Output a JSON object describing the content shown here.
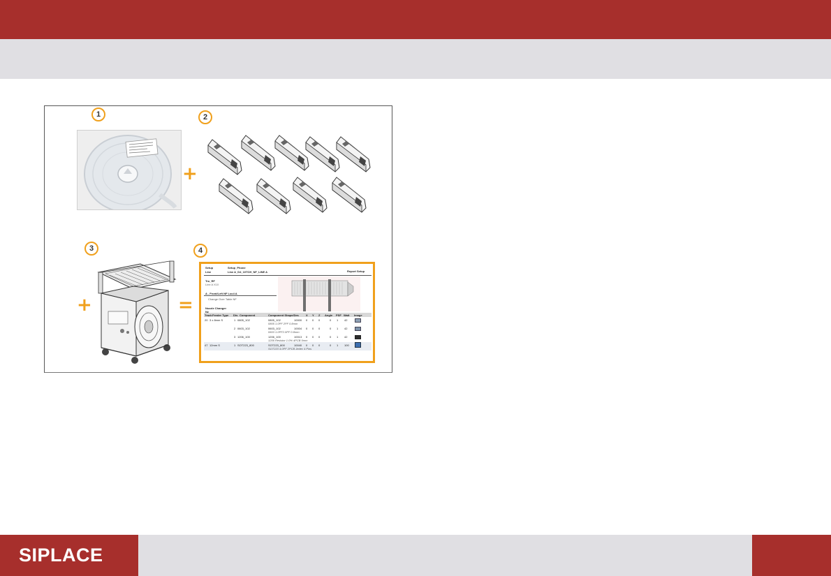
{
  "header": {
    "bar_color": "#a72f2c",
    "subbar_color": "#e0dfe3"
  },
  "figure": {
    "steps": [
      {
        "label": "1"
      },
      {
        "label": "2"
      },
      {
        "label": "3"
      },
      {
        "label": "4"
      }
    ],
    "operators": {
      "plus_1": "+",
      "plus_2": "+",
      "equals": "="
    },
    "accent_color": "#f0a01c",
    "report": {
      "setup_label": "Setup",
      "setup_value": "Setup_Phone",
      "line_label": "Line",
      "line_value": "Line A_D4_10TCH_NF_LINE A",
      "report_link": "Report Setup",
      "trolley_title": "Tro_RF",
      "trolley_sub": "Line A X10",
      "location_title": "A - Front/Left NF Loc4 A",
      "location_sub": "Change Over Table NF",
      "nozzle_title": "Nozzle Changer",
      "nozzle_sub": "Nz",
      "columns": [
        "Track",
        "Feeder Type",
        "Div.",
        "Component",
        "Component Shape/Des",
        "X",
        "Y",
        "Z",
        "Angle",
        "PSF",
        "Wait",
        "Image"
      ],
      "rows": [
        {
          "track": "20",
          "feeder": "3 x 8mm S",
          "div": "1",
          "comp": "0805_102",
          "shape": "0805_102",
          "code": "10000",
          "x": "0",
          "y": "0",
          "z": "0",
          "angle": "0",
          "psf": "1",
          "wait": "42",
          "desc": "0805 1.0PF 2PF 0.8mm"
        },
        {
          "track": "",
          "feeder": "",
          "div": "2",
          "comp": "0603_102",
          "shape": "0603_102",
          "code": "10004",
          "x": "0",
          "y": "0",
          "z": "0",
          "angle": "0",
          "psf": "1",
          "wait": "42",
          "desc": "0603 1.0PF2.0PF 0.8mm"
        },
        {
          "track": "",
          "feeder": "",
          "div": "3",
          "comp": "1206_100",
          "shape": "1206_100",
          "code": "10013",
          "x": "0",
          "y": "0",
          "z": "0",
          "angle": "0",
          "psf": "1",
          "wait": "42",
          "desc": "1206 Resistor 1.0% 4PCB 0mm"
        },
        {
          "track": "47",
          "feeder": "12mm S",
          "div": "1",
          "comp": "SOT223_800",
          "shape": "SOT223_800",
          "code": "10040",
          "x": "0",
          "y": "0",
          "z": "0",
          "angle": "0",
          "psf": "1",
          "wait": "100",
          "desc": "SOT223 4.0PF 2PCB Jedec 4 Pins"
        }
      ]
    }
  },
  "footer": {
    "logo": "SIPLACE",
    "bg_color": "#e0dfe3",
    "brand_color": "#a72f2c"
  }
}
